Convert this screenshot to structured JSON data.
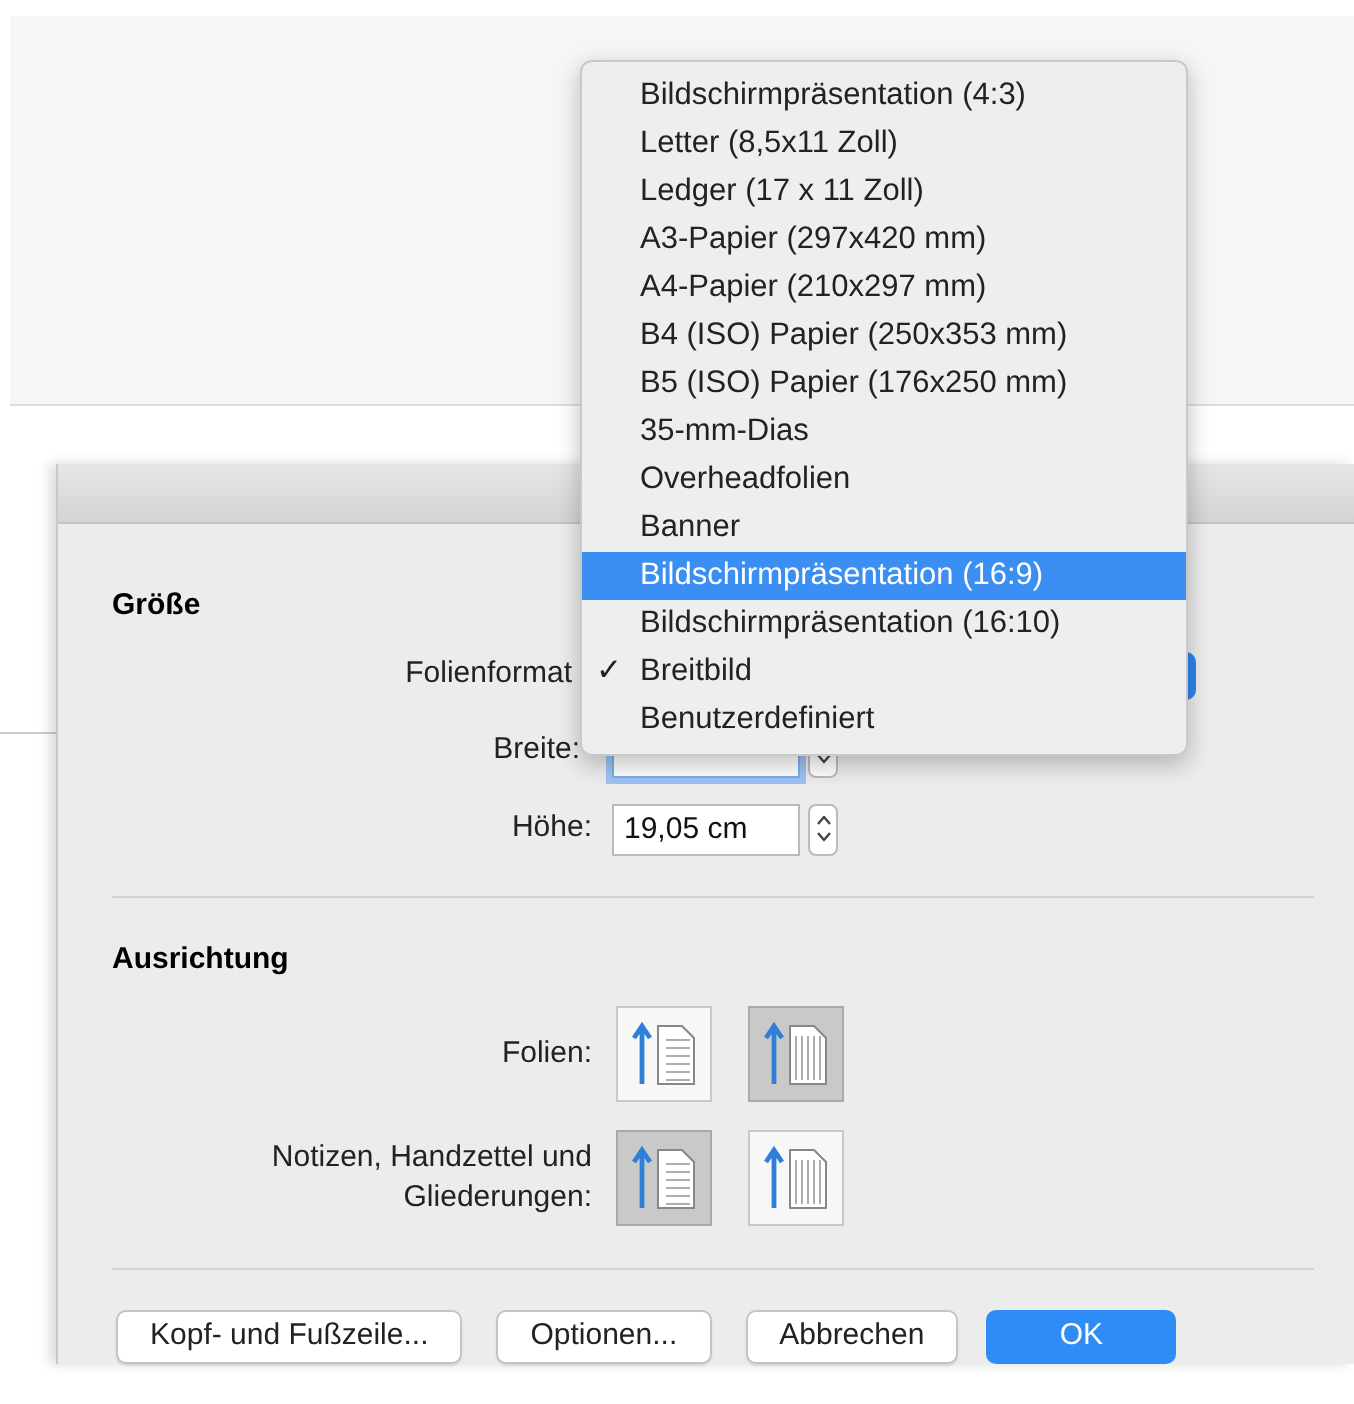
{
  "dialog": {
    "size_section": {
      "heading": "Größe",
      "slide_format": {
        "label": "Folienformat"
      },
      "width": {
        "label": "Breite:",
        "focused": true
      },
      "height": {
        "label": "Höhe:",
        "value": "19,05 cm",
        "focused": false
      }
    },
    "orientation_section": {
      "heading": "Ausrichtung",
      "rows": [
        {
          "label": "Folien:",
          "options": [
            {
              "kind": "portrait",
              "selected": false
            },
            {
              "kind": "landscape",
              "selected": true
            }
          ]
        },
        {
          "label": "Notizen, Handzettel und Gliederungen:",
          "options": [
            {
              "kind": "portrait",
              "selected": true
            },
            {
              "kind": "landscape",
              "selected": false
            }
          ]
        }
      ]
    },
    "buttons": [
      {
        "label": "Kopf- und Fußzeile...",
        "default": false
      },
      {
        "label": "Optionen...",
        "default": false
      },
      {
        "label": "Abbrechen",
        "default": false
      },
      {
        "label": "OK",
        "default": true
      }
    ]
  },
  "format_menu": {
    "check_mark": "✓",
    "items": [
      {
        "label": "Bildschirmpräsentation (4:3)",
        "selected": false,
        "checked": false
      },
      {
        "label": "Letter (8,5x11 Zoll)",
        "selected": false,
        "checked": false
      },
      {
        "label": "Ledger (17 x 11 Zoll)",
        "selected": false,
        "checked": false
      },
      {
        "label": "A3-Papier (297x420 mm)",
        "selected": false,
        "checked": false
      },
      {
        "label": "A4-Papier (210x297 mm)",
        "selected": false,
        "checked": false
      },
      {
        "label": "B4 (ISO) Papier (250x353 mm)",
        "selected": false,
        "checked": false
      },
      {
        "label": "B5 (ISO) Papier (176x250 mm)",
        "selected": false,
        "checked": false
      },
      {
        "label": "35-mm-Dias",
        "selected": false,
        "checked": false
      },
      {
        "label": "Overheadfolien",
        "selected": false,
        "checked": false
      },
      {
        "label": "Banner",
        "selected": false,
        "checked": false
      },
      {
        "label": "Bildschirmpräsentation (16:9)",
        "selected": true,
        "checked": false
      },
      {
        "label": "Bildschirmpräsentation (16:10)",
        "selected": false,
        "checked": false
      },
      {
        "label": "Breitbild",
        "selected": false,
        "checked": true
      },
      {
        "label": "Benutzerdefiniert",
        "selected": false,
        "checked": false
      }
    ]
  }
}
